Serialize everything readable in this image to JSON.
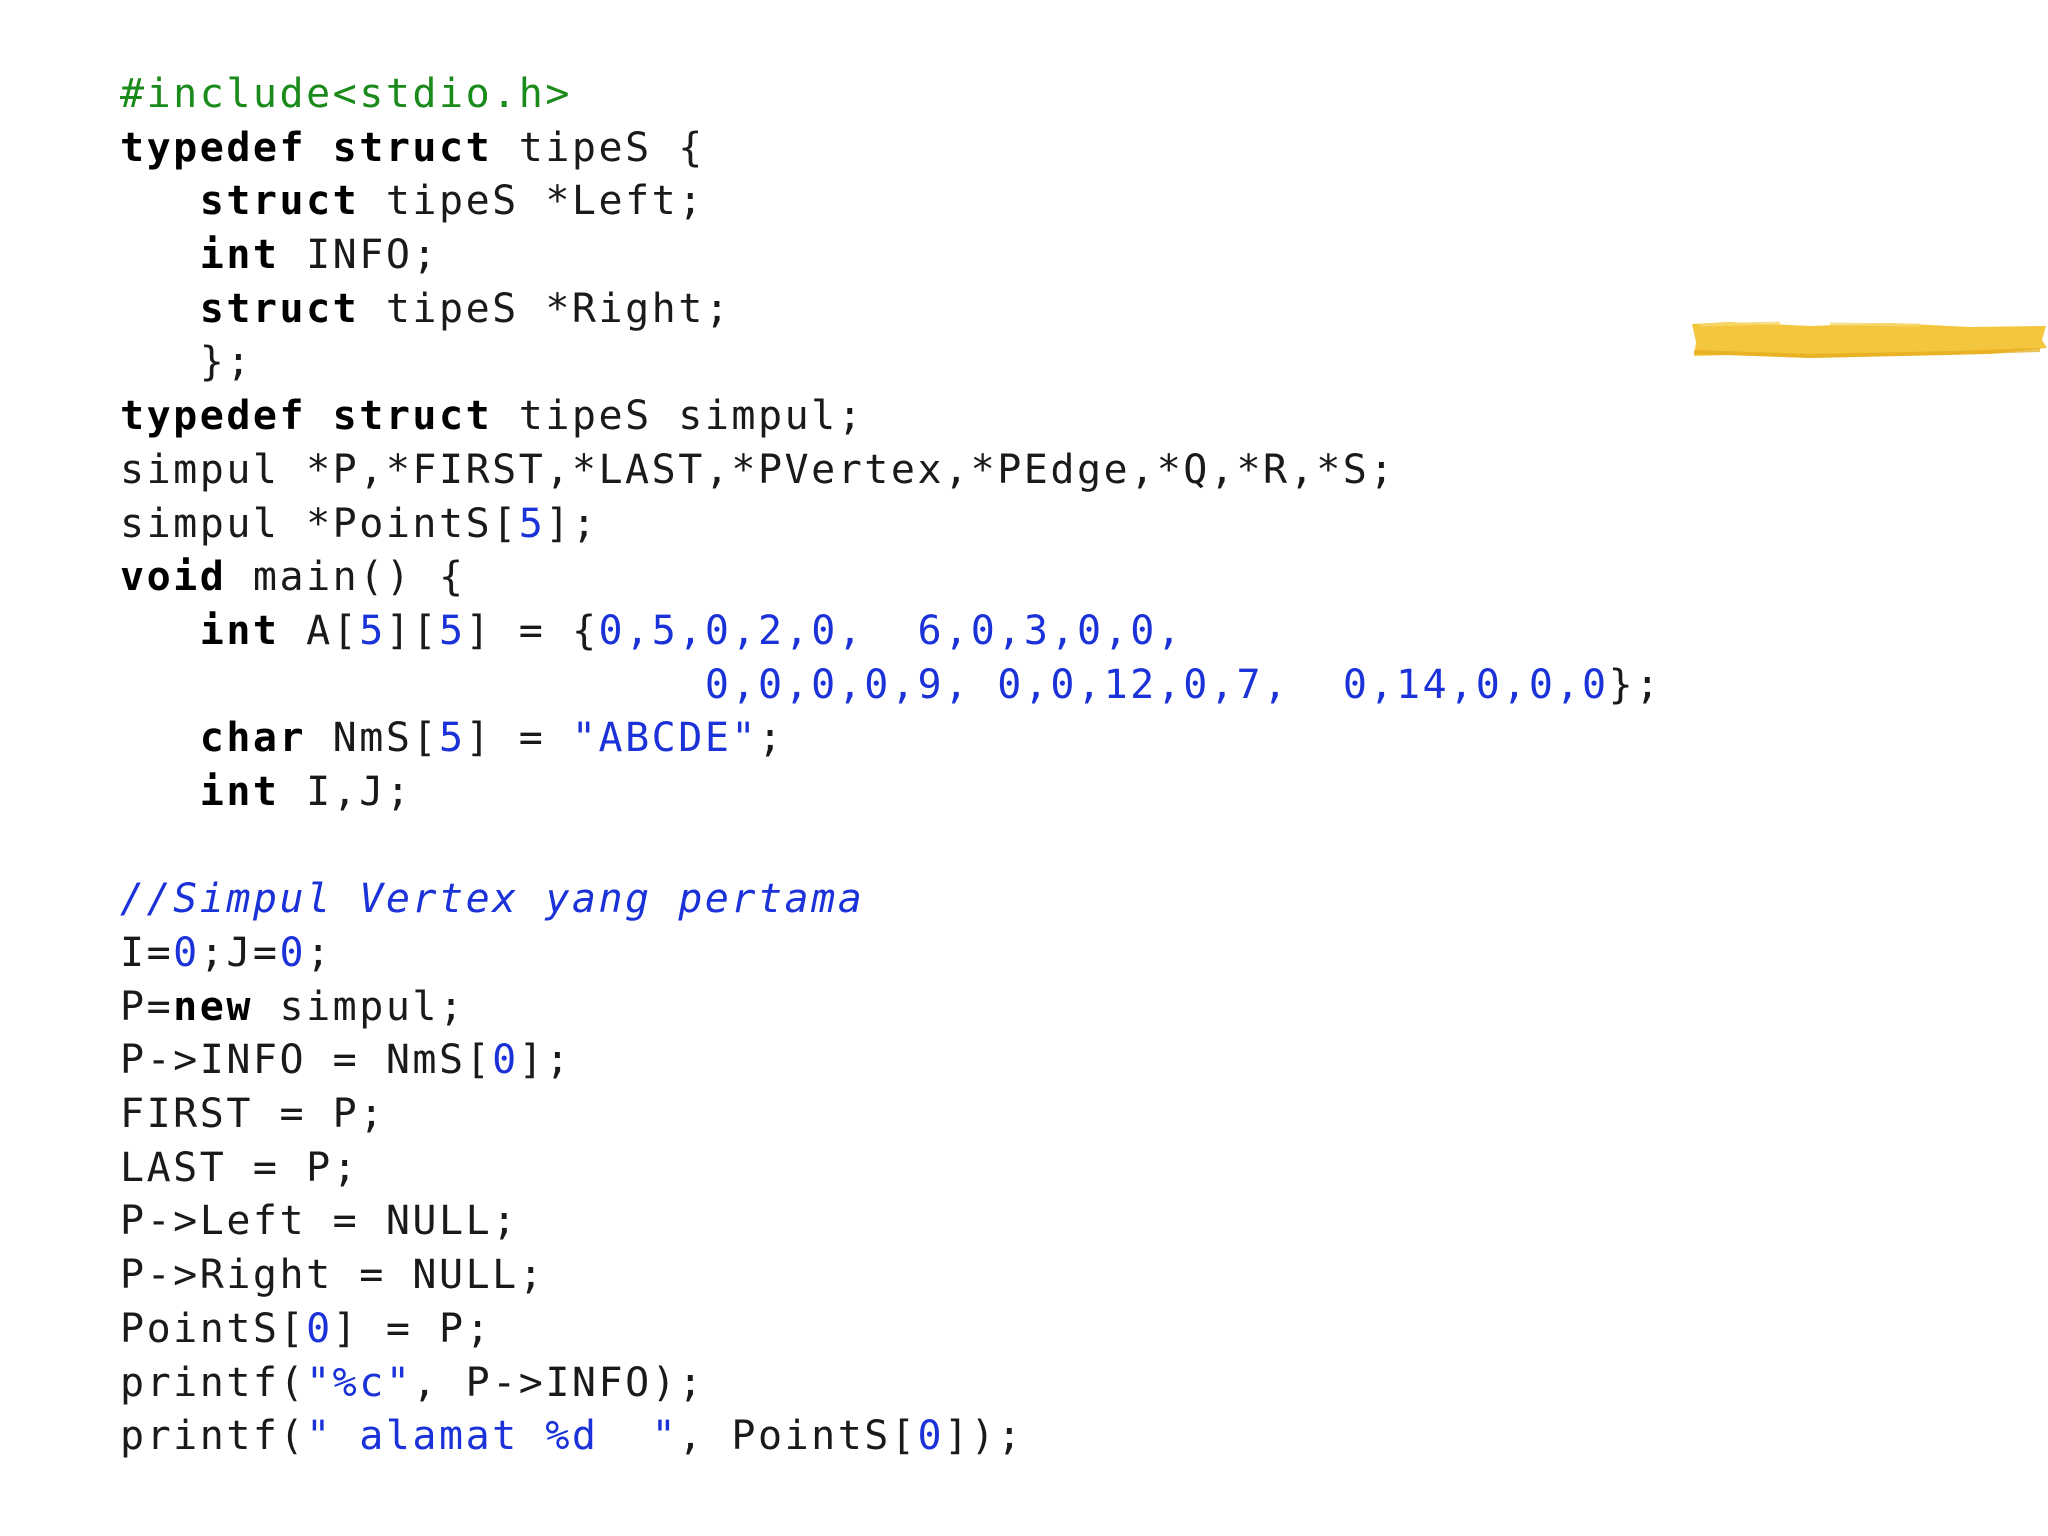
{
  "code": {
    "lines": [
      [
        [
          "pp",
          "#include<stdio.h>"
        ]
      ],
      [
        [
          "kw",
          "typedef"
        ],
        [
          "plain",
          " "
        ],
        [
          "kw",
          "struct"
        ],
        [
          "plain",
          " tipeS {"
        ]
      ],
      [
        [
          "plain",
          "   "
        ],
        [
          "kw",
          "struct"
        ],
        [
          "plain",
          " tipeS *Left;"
        ]
      ],
      [
        [
          "plain",
          "   "
        ],
        [
          "kw",
          "int"
        ],
        [
          "plain",
          " INFO;"
        ]
      ],
      [
        [
          "plain",
          "   "
        ],
        [
          "kw",
          "struct"
        ],
        [
          "plain",
          " tipeS *Right;"
        ]
      ],
      [
        [
          "plain",
          "   };"
        ]
      ],
      [
        [
          "kw",
          "typedef"
        ],
        [
          "plain",
          " "
        ],
        [
          "kw",
          "struct"
        ],
        [
          "plain",
          " tipeS simpul;"
        ]
      ],
      [
        [
          "plain",
          "simpul *P,*FIRST,*LAST,*PVertex,*PEdge,*Q,*R,*S;"
        ]
      ],
      [
        [
          "plain",
          "simpul *PointS["
        ],
        [
          "num",
          "5"
        ],
        [
          "plain",
          "];"
        ]
      ],
      [
        [
          "kw",
          "void"
        ],
        [
          "plain",
          " main() {"
        ]
      ],
      [
        [
          "plain",
          "   "
        ],
        [
          "kw",
          "int"
        ],
        [
          "plain",
          " A["
        ],
        [
          "num",
          "5"
        ],
        [
          "plain",
          "]["
        ],
        [
          "num",
          "5"
        ],
        [
          "plain",
          "] = {"
        ],
        [
          "num",
          "0,5,0,2,0,"
        ],
        [
          "plain",
          "  "
        ],
        [
          "num",
          "6,0,3,0,0,"
        ]
      ],
      [
        [
          "plain",
          "                      "
        ],
        [
          "num",
          "0,0,0,0,9,"
        ],
        [
          "plain",
          " "
        ],
        [
          "num",
          "0,0,12,0,7,"
        ],
        [
          "plain",
          "  "
        ],
        [
          "num",
          "0,14,0,0,0"
        ],
        [
          "plain",
          "};"
        ]
      ],
      [
        [
          "plain",
          "   "
        ],
        [
          "kw",
          "char"
        ],
        [
          "plain",
          " NmS["
        ],
        [
          "num",
          "5"
        ],
        [
          "plain",
          "] = "
        ],
        [
          "str",
          "\"ABCDE\""
        ],
        [
          "plain",
          ";"
        ]
      ],
      [
        [
          "plain",
          "   "
        ],
        [
          "kw",
          "int"
        ],
        [
          "plain",
          " I,J;"
        ]
      ],
      [],
      [
        [
          "cmt",
          "//Simpul Vertex yang pertama"
        ]
      ],
      [
        [
          "plain",
          "I="
        ],
        [
          "num",
          "0"
        ],
        [
          "plain",
          ";J="
        ],
        [
          "num",
          "0"
        ],
        [
          "plain",
          ";"
        ]
      ],
      [
        [
          "plain",
          "P="
        ],
        [
          "kw",
          "new"
        ],
        [
          "plain",
          " simpul;"
        ]
      ],
      [
        [
          "plain",
          "P->INFO = NmS["
        ],
        [
          "num",
          "0"
        ],
        [
          "plain",
          "];"
        ]
      ],
      [
        [
          "plain",
          "FIRST = P;"
        ]
      ],
      [
        [
          "plain",
          "LAST = P;"
        ]
      ],
      [
        [
          "plain",
          "P->Left = NULL;"
        ]
      ],
      [
        [
          "plain",
          "P->Right = NULL;"
        ]
      ],
      [
        [
          "plain",
          "PointS["
        ],
        [
          "num",
          "0"
        ],
        [
          "plain",
          "] = P;"
        ]
      ],
      [
        [
          "plain",
          "printf("
        ],
        [
          "str",
          "\"%c\""
        ],
        [
          "plain",
          ", P->INFO);"
        ]
      ],
      [
        [
          "plain",
          "printf("
        ],
        [
          "str",
          "\" alamat %d  \""
        ],
        [
          "plain",
          ", PointS["
        ],
        [
          "num",
          "0"
        ],
        [
          "plain",
          "]);"
        ]
      ]
    ]
  },
  "colors": {
    "keyword": "#000000",
    "number": "#1a32d8",
    "string": "#1a32d8",
    "comment": "#1a32d8",
    "preprocessor": "#1a8a1a",
    "highlight": "#f2c12e"
  }
}
